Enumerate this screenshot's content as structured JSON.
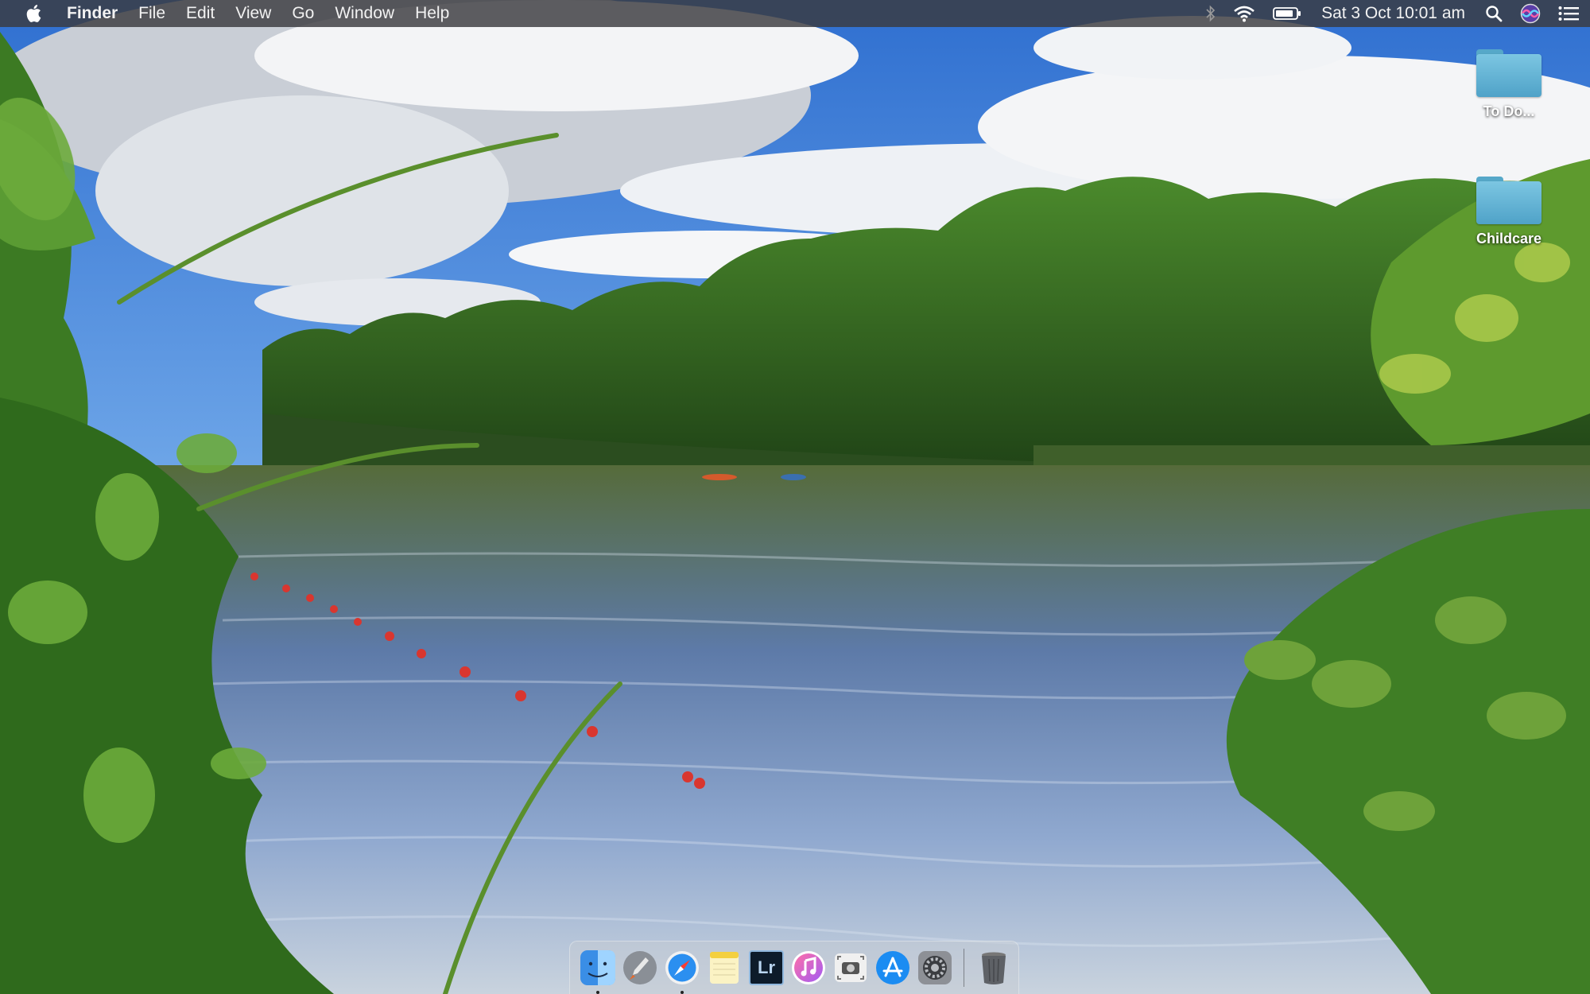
{
  "menubar": {
    "apple_icon": "apple-logo-icon",
    "app_name": "Finder",
    "menus": [
      "File",
      "Edit",
      "View",
      "Go",
      "Window",
      "Help"
    ],
    "status_icons": [
      "bluetooth-icon",
      "wifi-icon",
      "battery-icon"
    ],
    "clock": "Sat 3 Oct  10:01 am",
    "right_icons": [
      "spotlight-search-icon",
      "siri-icon",
      "notification-center-icon"
    ]
  },
  "desktop": {
    "icons": [
      {
        "label": "To Do...",
        "icon": "folder-icon"
      },
      {
        "label": "Childcare",
        "icon": "folder-icon"
      }
    ]
  },
  "dock": {
    "items": [
      {
        "name": "Finder",
        "icon": "finder-icon",
        "running": true
      },
      {
        "name": "Launchpad",
        "icon": "launchpad-icon",
        "running": false
      },
      {
        "name": "Safari",
        "icon": "safari-icon",
        "running": true
      },
      {
        "name": "Notes",
        "icon": "notes-icon",
        "running": false
      },
      {
        "name": "Lightroom",
        "icon": "lightroom-icon",
        "label": "Lr",
        "running": false
      },
      {
        "name": "iTunes",
        "icon": "itunes-icon",
        "running": false
      },
      {
        "name": "Screenshot",
        "icon": "screenshot-icon",
        "running": false
      },
      {
        "name": "App Store",
        "icon": "app-store-icon",
        "running": false
      },
      {
        "name": "System Preferences",
        "icon": "system-preferences-icon",
        "running": false
      }
    ],
    "trash_icon": "trash-icon"
  },
  "colors": {
    "menubar_bg": "#3a3a3e",
    "folder_blue": "#5fb0d4"
  }
}
